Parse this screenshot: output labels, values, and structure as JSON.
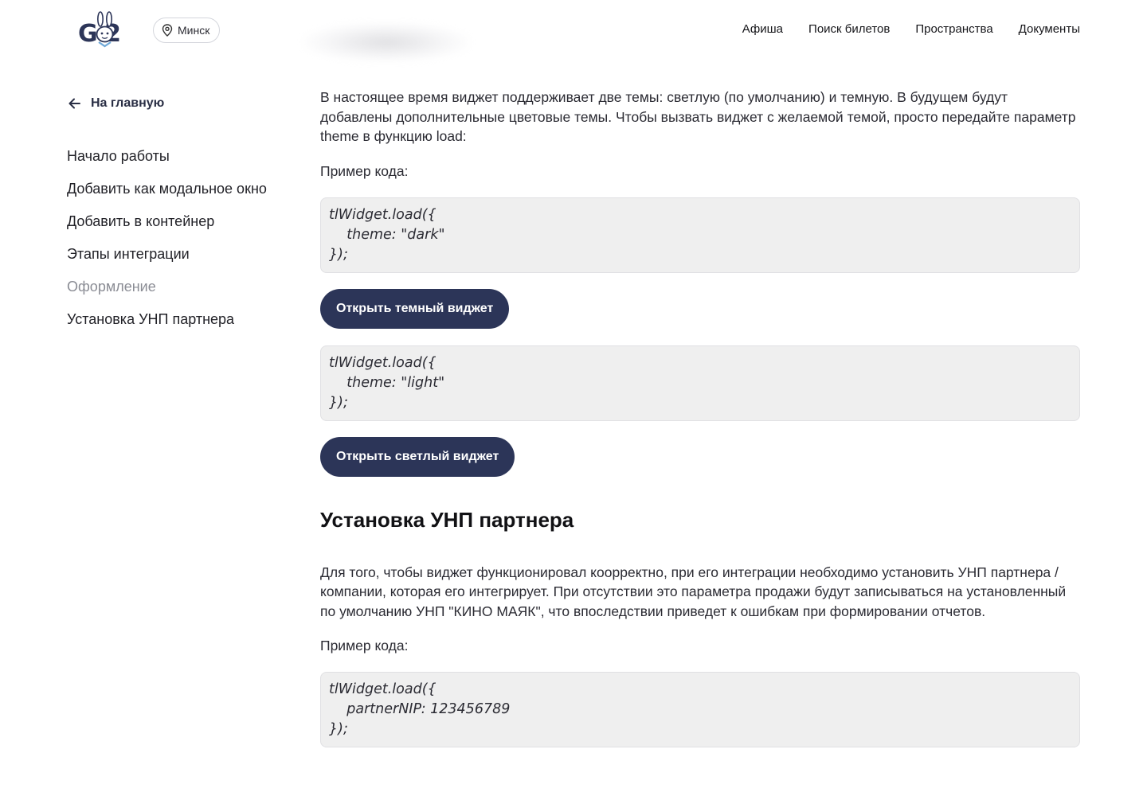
{
  "header": {
    "logo_text": "G 2",
    "city": "Минск",
    "nav": [
      "Афиша",
      "Поиск билетов",
      "Пространства",
      "Документы"
    ]
  },
  "sidebar": {
    "back_label": "На главную",
    "items": [
      "Начало работы",
      "Добавить как модальное окно",
      "Добавить в контейнер",
      "Этапы интеграции",
      "Оформление",
      "Установка УНП партнера"
    ],
    "active_index": 4
  },
  "content": {
    "theme_paragraph": "В настоящее время виджет поддерживает две темы: светлую (по умолчанию) и темную. В будущем будут добавлены дополнительные цветовые темы. Чтобы вызвать виджет с желаемой темой, просто передайте параметр theme в функцию load:",
    "example_label_1": "Пример кода:",
    "code_dark": "tlWidget.load({\n    theme: \"dark\"\n});",
    "btn_dark": "Открыть темный виджет",
    "code_light": "tlWidget.load({\n    theme: \"light\"\n});",
    "btn_light": "Открыть светлый виджет",
    "section_title": "Установка УНП партнера",
    "unp_paragraph": "Для того, чтобы виджет функционировал коорректно, при его интеграции необходимо установить УНП партнера / компании, которая его интегрирует. При отсутствии это параметра продажи будут записываться на установленный по умолчанию УНП \"КИНО МАЯК\", что впоследствии приведет к ошибкам при формировании отчетов.",
    "example_label_2": "Пример кода:",
    "code_unp": "tlWidget.load({\n    partnerNIP: 123456789\n});"
  },
  "colors": {
    "accent": "#2c3558",
    "code_bg": "#efefef",
    "muted_text": "#8a8c94"
  },
  "icons": {
    "back": "arrow-left-icon",
    "location": "location-pin-icon",
    "logo": "bunny-mascot-icon"
  }
}
